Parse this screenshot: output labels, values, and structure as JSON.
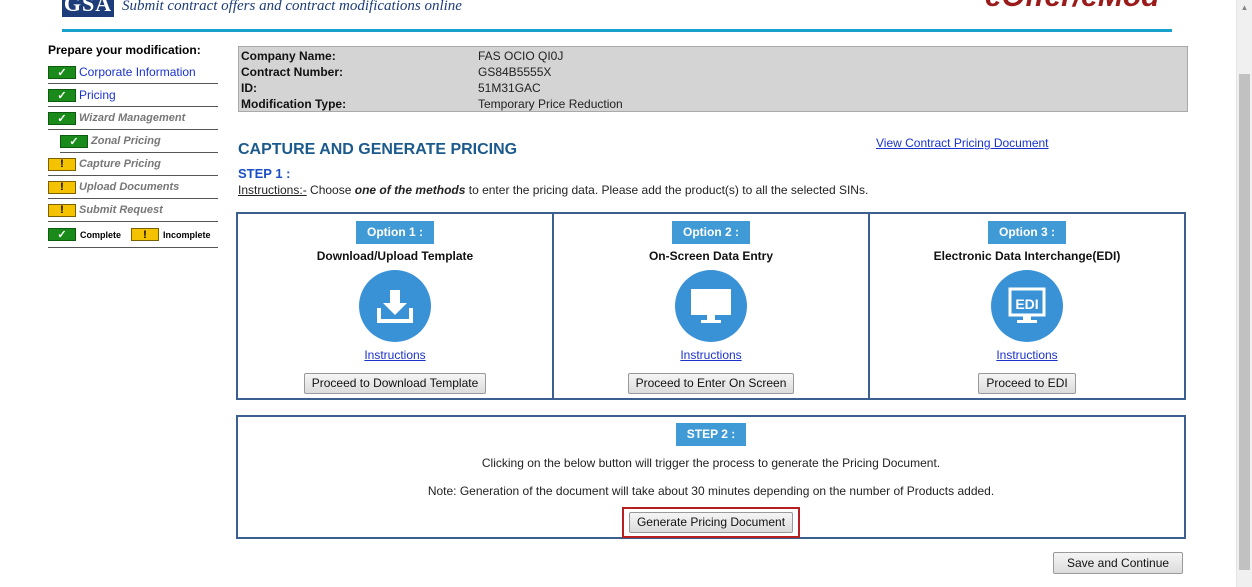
{
  "header": {
    "logo": "GSA",
    "tagline": "Submit contract offers and contract modifications online",
    "brand": "eOffer/eMod"
  },
  "sidebar": {
    "title": "Prepare your modification:",
    "items": [
      {
        "label": "Corporate Information",
        "status": "complete"
      },
      {
        "label": "Pricing",
        "status": "complete"
      },
      {
        "label": "Wizard Management",
        "status": "complete"
      },
      {
        "label": "Zonal Pricing",
        "status": "complete"
      },
      {
        "label": "Capture Pricing",
        "status": "incomplete"
      },
      {
        "label": "Upload Documents",
        "status": "incomplete"
      },
      {
        "label": "Submit Request",
        "status": "incomplete"
      }
    ],
    "legend": {
      "complete": "Complete",
      "incomplete": "Incomplete"
    },
    "check_glyph": "✓",
    "warn_glyph": "!"
  },
  "info": {
    "company_label": "Company Name:",
    "company_value": "FAS OCIO QI0J",
    "contract_label": "Contract Number:",
    "contract_value": "GS84B5555X",
    "id_label": "ID:",
    "id_value": "51M31GAC",
    "mod_label": "Modification Type:",
    "mod_value": "Temporary Price Reduction"
  },
  "view_link": "View Contract Pricing Document",
  "page_title": "CAPTURE AND GENERATE PRICING",
  "step1": {
    "label": "STEP 1 :",
    "instr_prefix": "Instructions:-",
    "instr_a": " Choose ",
    "instr_em": "one of the methods",
    "instr_b": " to enter the pricing data. Please add the product(s) to all the selected SINs."
  },
  "options": [
    {
      "tag": "Option 1 :",
      "title": "Download/Upload Template",
      "icon": "download-icon",
      "instr": "Instructions ",
      "button": "Proceed to Download Template"
    },
    {
      "tag": "Option 2 :",
      "title": "On-Screen Data Entry",
      "icon": "monitor-icon",
      "instr": "Instructions ",
      "button": "Proceed to Enter On Screen"
    },
    {
      "tag": "Option 3 :",
      "title": "Electronic Data Interchange(EDI)",
      "icon": "edi-monitor-icon",
      "icon_text": "EDI",
      "instr": "Instructions",
      "button": "Proceed to EDI"
    }
  ],
  "step2": {
    "tag": "STEP 2 :",
    "line1": "Clicking on the below button will trigger the process to generate the Pricing Document.",
    "line2": "Note: Generation of the document will take about 30 minutes depending on the number of Products added.",
    "button": "Generate Pricing Document"
  },
  "save_button": "Save and Continue",
  "colors": {
    "accent": "#3f9ad6",
    "title": "#1b5a8c",
    "highlight": "#b72020",
    "complete": "#1a8a1a",
    "incomplete": "#f5c200"
  }
}
